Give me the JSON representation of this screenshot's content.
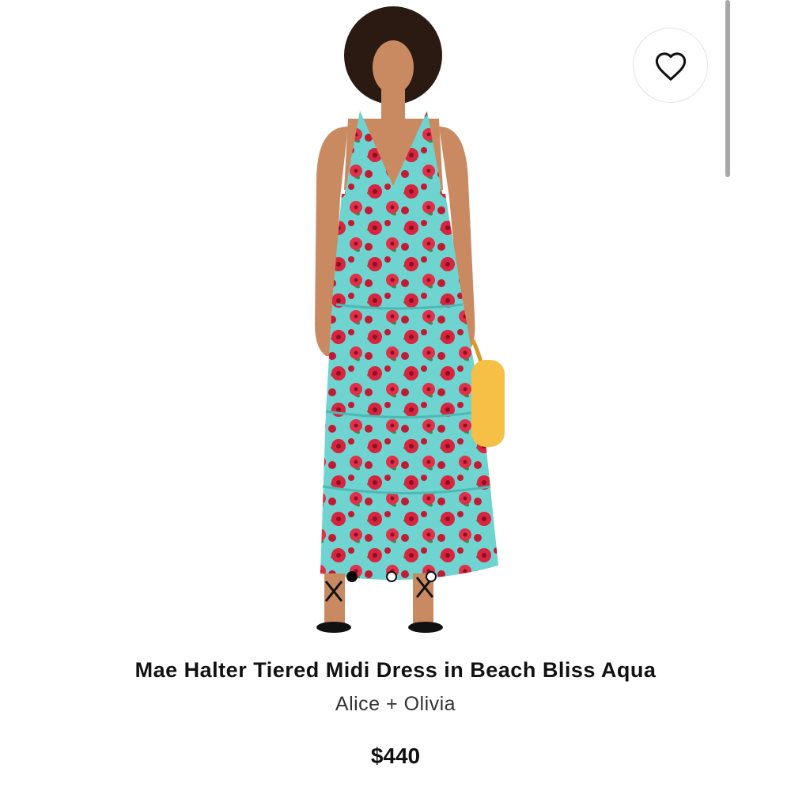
{
  "product": {
    "title": "Mae Halter Tiered Midi Dress in Beach Bliss Aqua",
    "brand": "Alice + Olivia",
    "price": "$440"
  },
  "favorite": {
    "icon": "heart-outline-icon",
    "favorited": false
  },
  "carousel": {
    "total_images": 3,
    "active_index": 0
  },
  "colors": {
    "dress_base": "#6fd3cf",
    "flower": "#d8243f",
    "bag": "#f6c047",
    "skin": "#c98a62",
    "hair": "#2a1a12",
    "text": "#111111"
  }
}
